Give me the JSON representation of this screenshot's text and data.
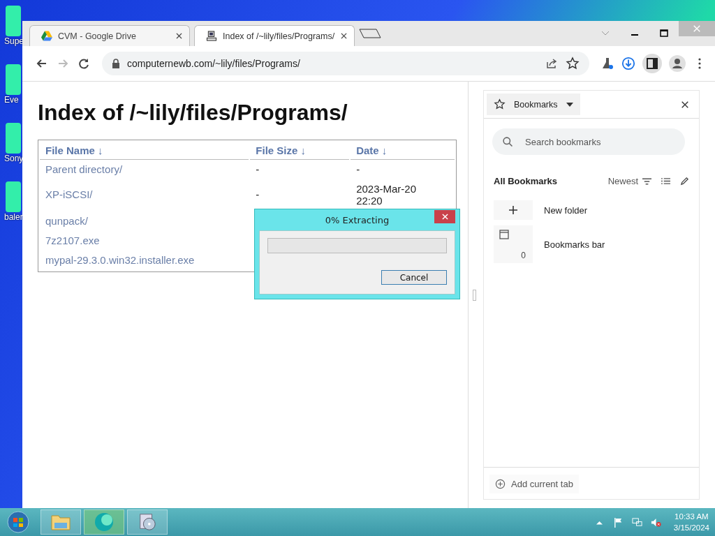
{
  "desktop_icons": [
    {
      "label": "Supe"
    },
    {
      "label": "Eve"
    },
    {
      "label": "Sony"
    },
    {
      "label": "baler"
    }
  ],
  "tabs": [
    {
      "title": "CVM - Google Drive",
      "selected": false
    },
    {
      "title": "Index of /~lily/files/Programs/",
      "selected": true
    }
  ],
  "address_bar": {
    "url": "computernewb.com/~lily/files/Programs/"
  },
  "page": {
    "heading": "Index of /~lily/files/Programs/",
    "table": {
      "columns": [
        "File Name ↓",
        "File Size ↓",
        "Date ↓"
      ],
      "rows": [
        {
          "cells": [
            "Parent directory/",
            "-",
            "-"
          ]
        },
        {
          "cells": [
            "XP-iSCSI/",
            "-",
            "2023-Mar-20 22:20"
          ]
        },
        {
          "cells": [
            "qunpack/"
          ]
        },
        {
          "cells": [
            "7z2107.exe"
          ]
        },
        {
          "cells": [
            "mypal-29.3.0.win32.installer.exe"
          ]
        }
      ]
    }
  },
  "side_panel": {
    "selector": "Bookmarks",
    "search_placeholder": "Search bookmarks",
    "section_title": "All Bookmarks",
    "sort": "Newest",
    "items": [
      {
        "kind": "action",
        "label": "New folder"
      },
      {
        "kind": "folder",
        "label": "Bookmarks bar",
        "count": "0"
      }
    ],
    "add_button": "Add current tab"
  },
  "dialog": {
    "title": "0% Extracting",
    "level": 0,
    "cancel": "Cancel"
  },
  "taskbar": {
    "time": "10:33 AM",
    "date": "3/15/2024"
  }
}
